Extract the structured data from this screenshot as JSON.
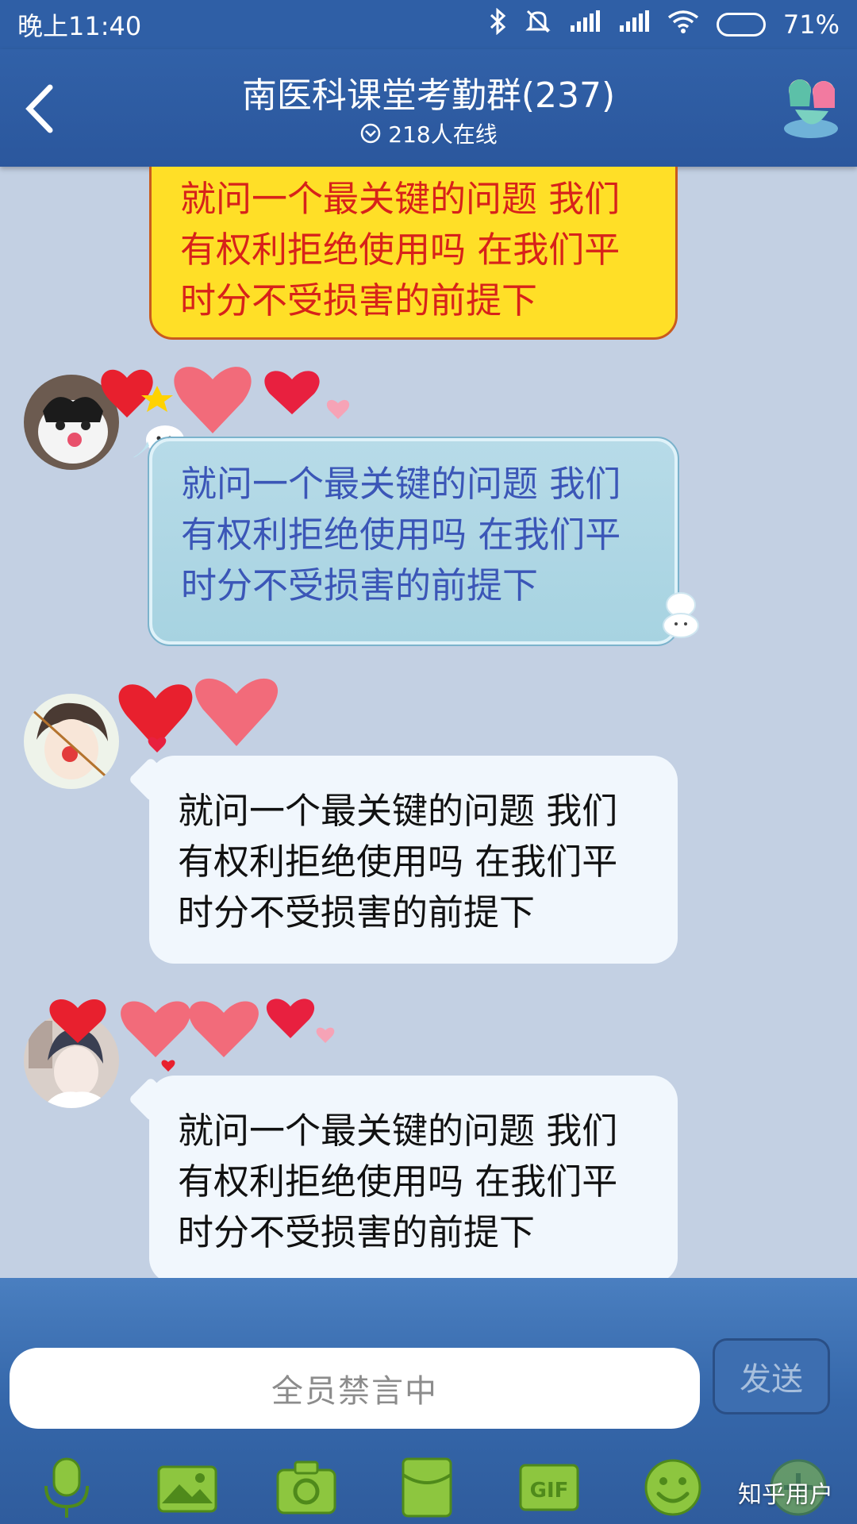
{
  "status_bar": {
    "time": "晚上11:40",
    "battery": "71%",
    "battery_level": 0.71
  },
  "header": {
    "title": "南医科课堂考勤群(237)",
    "online": "218人在线"
  },
  "messages": [
    {
      "id": "msg1",
      "text": "就问一个最关键的问题 我们有权利拒绝使用吗 在我们平时分不受损害的前提下",
      "style": "yellow"
    },
    {
      "id": "msg2",
      "text": "就问一个最关键的问题 我们有权利拒绝使用吗 在我们平时分不受损害的前提下",
      "style": "blue"
    },
    {
      "id": "msg3",
      "text": "就问一个最关键的问题 我们有权利拒绝使用吗 在我们平时分不受损害的前提下",
      "style": "white"
    },
    {
      "id": "msg4",
      "text": "就问一个最关键的问题 我们有权利拒绝使用吗 在我们平时分不受损害的前提下",
      "style": "white"
    }
  ],
  "input": {
    "placeholder": "全员禁言中"
  },
  "send_label": "发送",
  "toolbar_icons": [
    "microphone-icon",
    "photo-icon",
    "camera-icon",
    "red-packet-icon",
    "gif-icon",
    "emoji-icon",
    "plus-icon"
  ],
  "watermark": "知乎用户",
  "colors": {
    "header_blue": "#2f5fa6",
    "chat_bg": "#c3d0e3",
    "yellow_bubble": "#ffdf27",
    "yellow_text": "#d7221a",
    "blue_bubble": "#b7dbe8",
    "blue_text": "#3b56b7",
    "white_bubble": "#f1f7fd",
    "icon_green": "#8dc63f"
  }
}
